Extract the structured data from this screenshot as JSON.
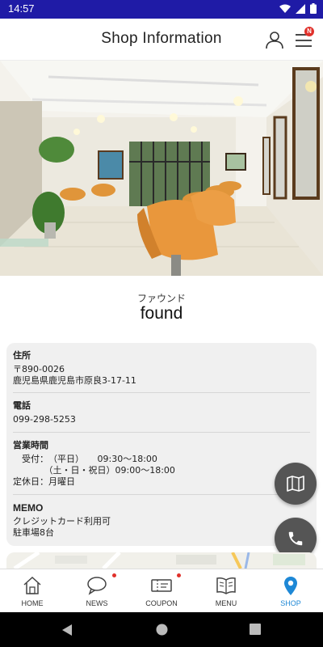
{
  "status_bar": {
    "time": "14:57"
  },
  "header": {
    "title": "Shop Information",
    "menu_badge": "N"
  },
  "shop": {
    "name_kana": "ファウンド",
    "name": "found"
  },
  "info": {
    "address_label": "住所",
    "postal_code": "〒890-0026",
    "address": "鹿児島県鹿児島市原良3-17-11",
    "phone_label": "電話",
    "phone": "099-298-5253",
    "hours_label": "営業時間",
    "hours_lines": [
      "　受付：　（平日）　　09:30〜18:00",
      "　　　　（土・日・祝日）09:00〜18:00",
      "定休日：月曜日"
    ],
    "memo_label": "MEMO",
    "memo_lines": [
      "クレジットカード利用可",
      "駐車場8台"
    ]
  },
  "fabs": {
    "map": "map-icon",
    "phone": "phone-icon"
  },
  "bottom_nav": [
    {
      "label": "HOME",
      "icon": "home-icon",
      "dot": false,
      "active": false
    },
    {
      "label": "NEWS",
      "icon": "chat-bubble-icon",
      "dot": true,
      "active": false
    },
    {
      "label": "COUPON",
      "icon": "coupon-icon",
      "dot": true,
      "active": false
    },
    {
      "label": "MENU",
      "icon": "book-icon",
      "dot": false,
      "active": false
    },
    {
      "label": "SHOP",
      "icon": "location-pin-icon",
      "dot": false,
      "active": true
    }
  ],
  "colors": {
    "status_bar": "#1f1ba6",
    "accent": "#1e88d6",
    "badge": "#e0312b",
    "fab": "#555555"
  }
}
